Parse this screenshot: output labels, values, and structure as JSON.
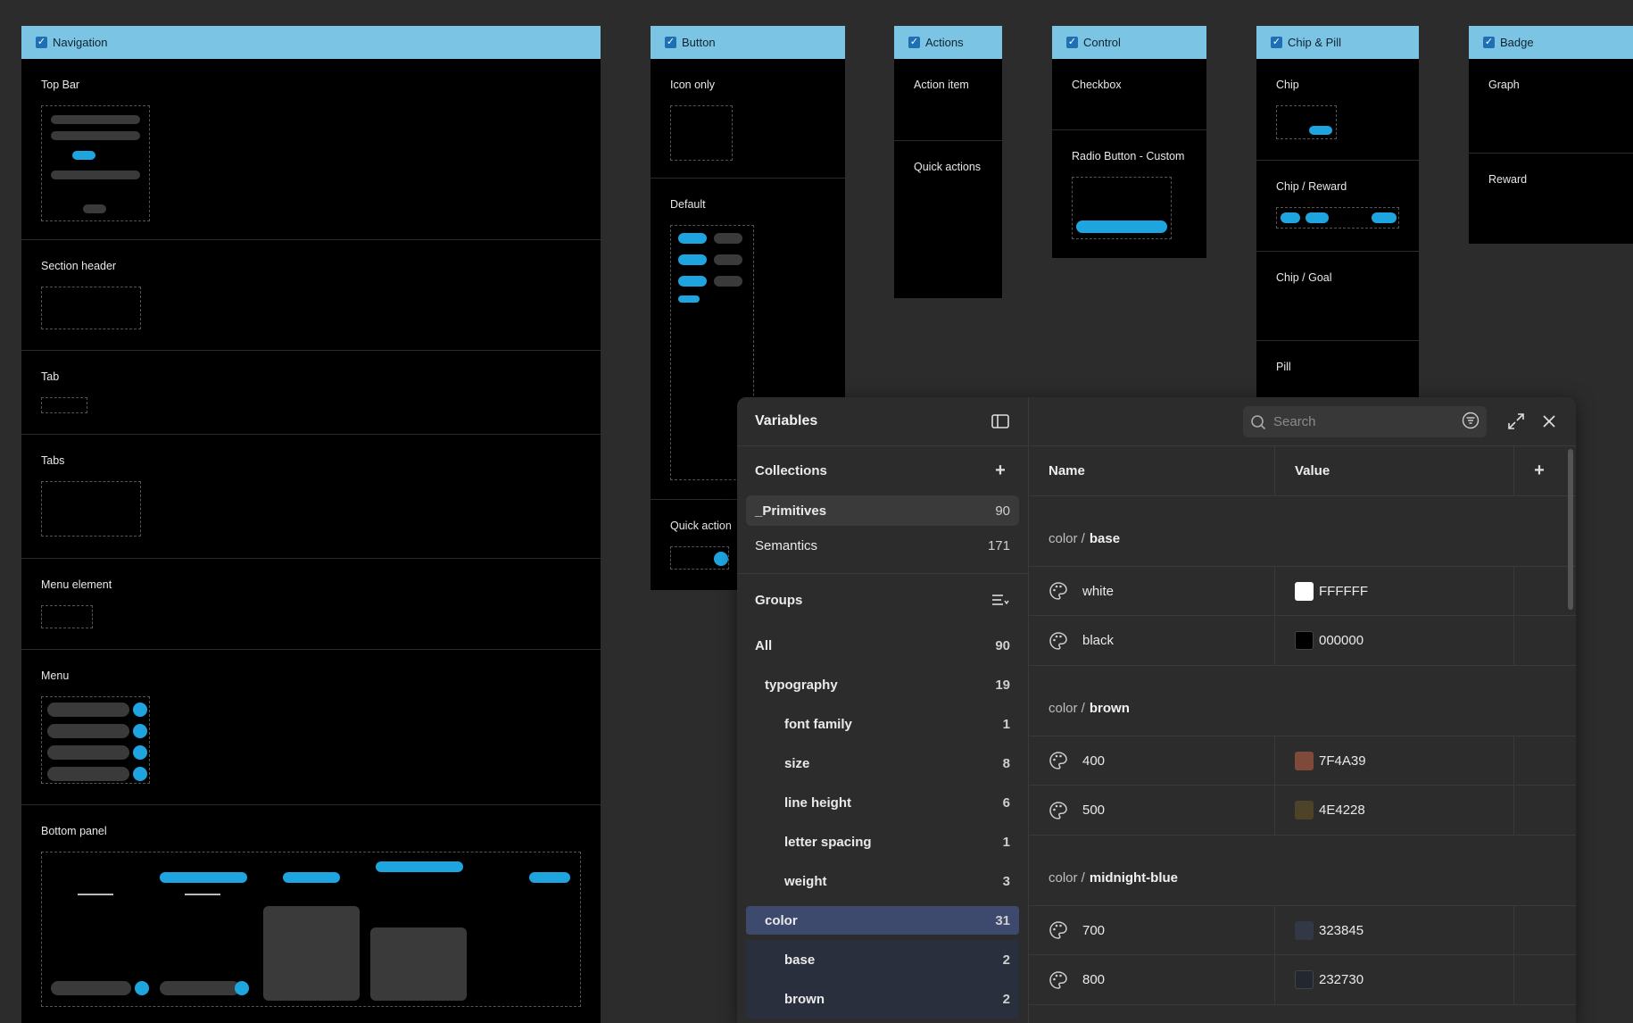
{
  "frames": {
    "navigation": {
      "title": "Navigation",
      "sections": [
        "Top Bar",
        "Section header",
        "Tab",
        "Tabs",
        "Menu element",
        "Menu",
        "Bottom panel"
      ]
    },
    "button": {
      "title": "Button",
      "sections": [
        "Icon only",
        "Default",
        "Quick action"
      ]
    },
    "actions": {
      "title": "Actions",
      "sections": [
        "Action item",
        "Quick actions"
      ]
    },
    "control": {
      "title": "Control",
      "sections": [
        "Checkbox",
        "Radio Button - Custom"
      ]
    },
    "chip": {
      "title": "Chip & Pill",
      "sections": [
        "Chip",
        "Chip / Reward",
        "Chip / Goal",
        "Pill"
      ]
    },
    "badge": {
      "title": "Badge",
      "sections": [
        "Graph",
        "Reward"
      ]
    }
  },
  "variables": {
    "title": "Variables",
    "search_placeholder": "Search",
    "collections_label": "Collections",
    "collections": [
      {
        "name": "_Primitives",
        "count": "90"
      },
      {
        "name": "Semantics",
        "count": "171"
      }
    ],
    "groups_label": "Groups",
    "groups": [
      {
        "name": "All",
        "count": "90"
      },
      {
        "name": "typography",
        "count": "19"
      },
      {
        "name": "font family",
        "count": "1"
      },
      {
        "name": "size",
        "count": "8"
      },
      {
        "name": "line height",
        "count": "6"
      },
      {
        "name": "letter spacing",
        "count": "1"
      },
      {
        "name": "weight",
        "count": "3"
      },
      {
        "name": "color",
        "count": "31"
      },
      {
        "name": "base",
        "count": "2"
      },
      {
        "name": "brown",
        "count": "2"
      }
    ],
    "table": {
      "col_name": "Name",
      "col_value": "Value",
      "groups": [
        {
          "prefix": "color /",
          "name": "base",
          "rows": [
            {
              "name": "white",
              "value": "FFFFFF",
              "color": "#FFFFFF"
            },
            {
              "name": "black",
              "value": "000000",
              "color": "#000000"
            }
          ]
        },
        {
          "prefix": "color /",
          "name": "brown",
          "rows": [
            {
              "name": "400",
              "value": "7F4A39",
              "color": "#7F4A39"
            },
            {
              "name": "500",
              "value": "4E4228",
              "color": "#4E4228"
            }
          ]
        },
        {
          "prefix": "color /",
          "name": "midnight-blue",
          "rows": [
            {
              "name": "700",
              "value": "323845",
              "color": "#323845"
            },
            {
              "name": "800",
              "value": "232730",
              "color": "#232730"
            }
          ]
        }
      ]
    }
  },
  "colors": {
    "accent": "#1ea5e0",
    "header": "#7cc4e4",
    "selected_group": "#3d4a6e"
  }
}
